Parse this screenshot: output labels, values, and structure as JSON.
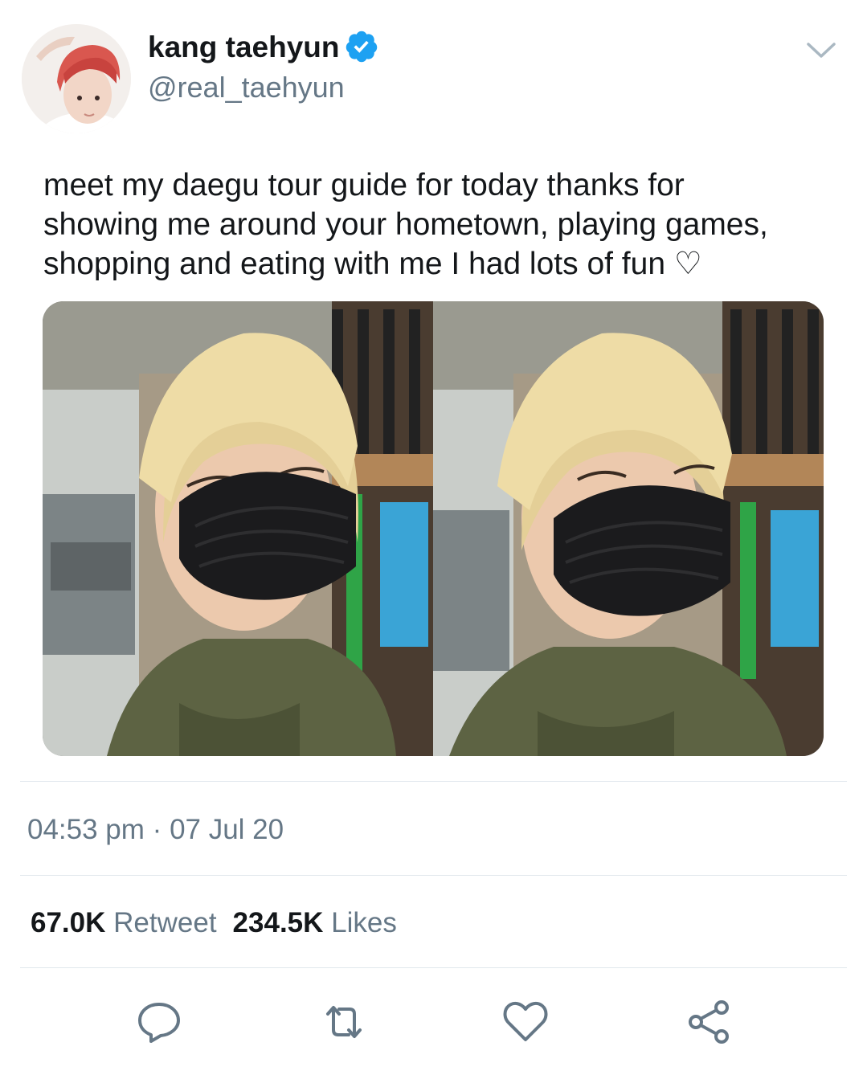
{
  "author": {
    "display_name": "kang taehyun",
    "handle": "@real_taehyun",
    "verified": true,
    "avatar_icon": "profile-photo"
  },
  "menu_icon": "chevron-down-icon",
  "tweet": {
    "text": "meet my daegu tour guide for today thanks for\nshowing me around your hometown, playing games,\nshopping and eating with me I had lots of fun ♡",
    "media": [
      "photo-1",
      "photo-2"
    ]
  },
  "meta": {
    "time": "04:53 pm",
    "separator": "·",
    "date": "07 Jul 20"
  },
  "stats": {
    "retweets_count": "67.0K",
    "retweets_label": "Retweet",
    "likes_count": "234.5K",
    "likes_label": "Likes"
  },
  "actions": [
    "reply-icon",
    "retweet-icon",
    "like-icon",
    "share-icon"
  ],
  "colors": {
    "verified_blue": "#1da1f2",
    "secondary_text": "#657786",
    "primary_text": "#14171a",
    "divider": "#e1e8ed"
  }
}
